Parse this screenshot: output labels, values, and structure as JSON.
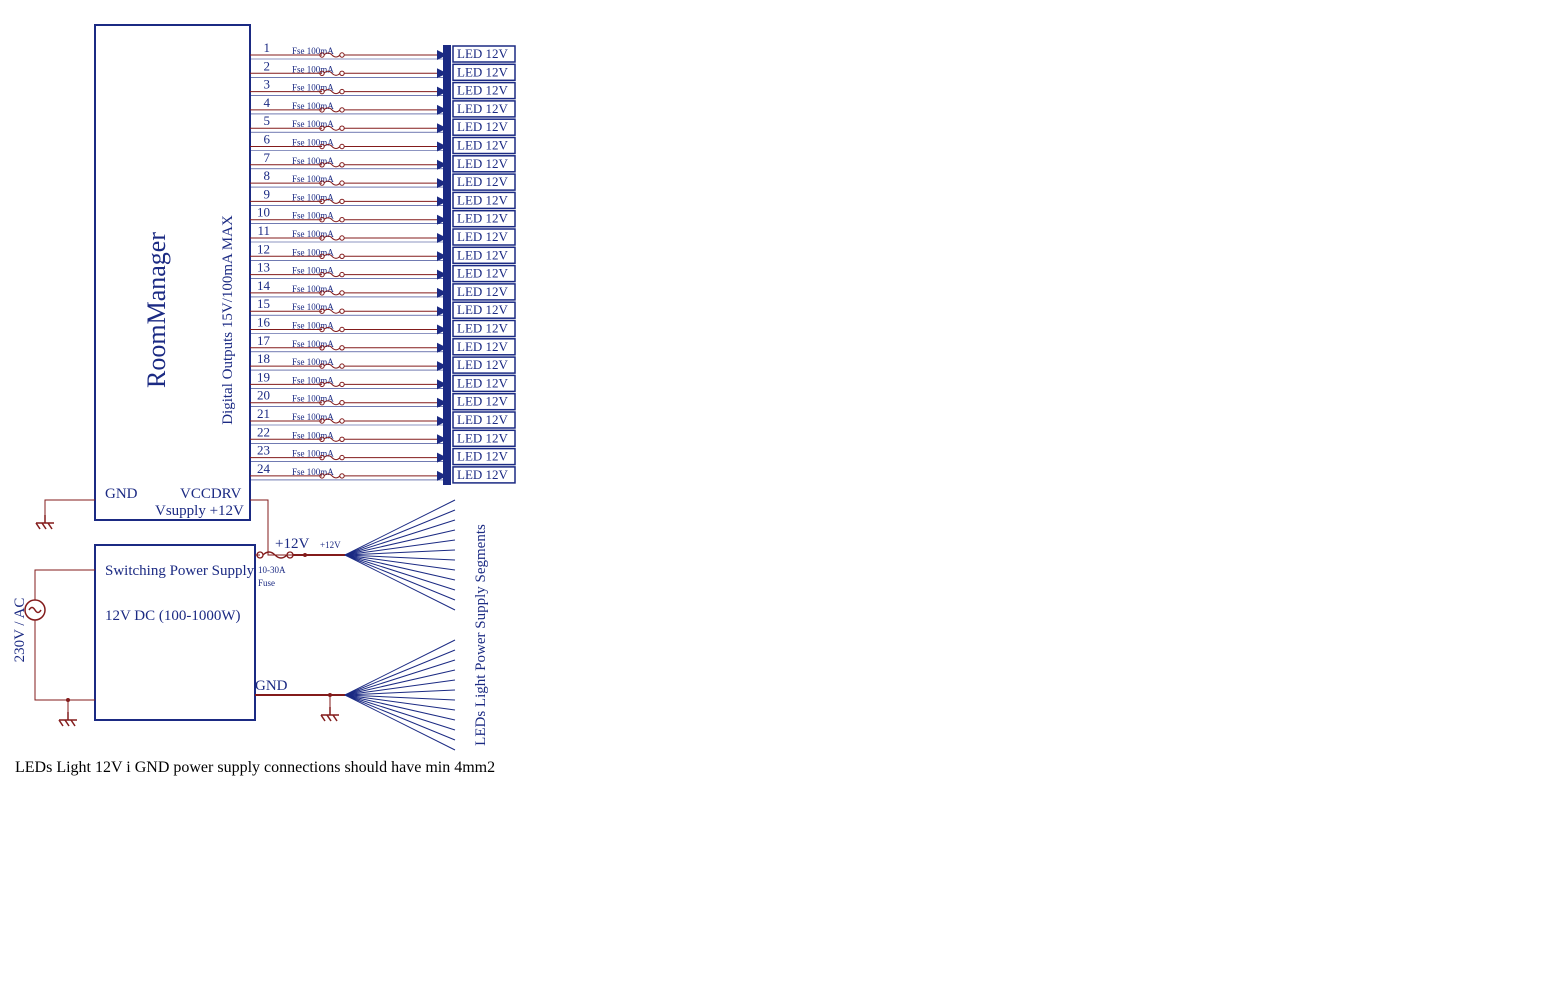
{
  "rm": {
    "title": "RoomManager",
    "outputs_label": "Digital Outputs 15V/100mA MAX",
    "gnd": "GND",
    "vccdrv": "VCCDRV",
    "vsupply": "Vsupply +12V"
  },
  "fuse_label": "Fse 100mA",
  "led_label": "LED 12V",
  "channels": [
    {
      "n": "1"
    },
    {
      "n": "2"
    },
    {
      "n": "3"
    },
    {
      "n": "4"
    },
    {
      "n": "5"
    },
    {
      "n": "6"
    },
    {
      "n": "7"
    },
    {
      "n": "8"
    },
    {
      "n": "9"
    },
    {
      "n": "10"
    },
    {
      "n": "11"
    },
    {
      "n": "12"
    },
    {
      "n": "13"
    },
    {
      "n": "14"
    },
    {
      "n": "15"
    },
    {
      "n": "16"
    },
    {
      "n": "17"
    },
    {
      "n": "18"
    },
    {
      "n": "19"
    },
    {
      "n": "20"
    },
    {
      "n": "21"
    },
    {
      "n": "22"
    },
    {
      "n": "23"
    },
    {
      "n": "24"
    }
  ],
  "psu": {
    "title": "Switching Power Supply",
    "spec": "12V DC (100-1000W)",
    "ac": "230V / AC",
    "outp": "+12V",
    "outp_small": "+12V",
    "fuse": "10-30A",
    "fuse2": "Fuse",
    "gnd": "GND"
  },
  "segments_label": "LEDs Light Power Supply Segments",
  "footnote": "LEDs Light 12V i GND power supply connections should have min 4mm2"
}
